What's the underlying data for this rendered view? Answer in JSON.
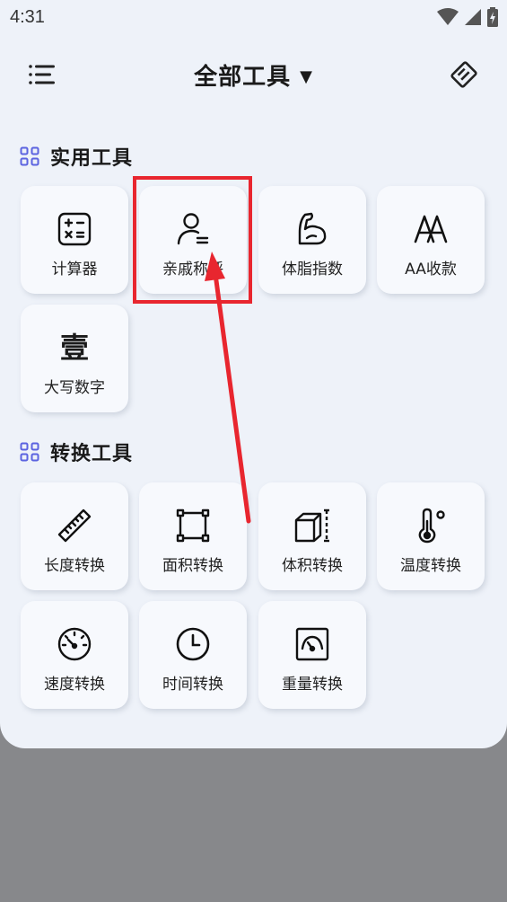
{
  "status": {
    "time": "4:31"
  },
  "header": {
    "title": "全部工具",
    "caret": "▼"
  },
  "sections": [
    {
      "title": "实用工具",
      "tools": [
        {
          "label": "计算器",
          "icon": "calculator-icon"
        },
        {
          "label": "亲戚称呼",
          "icon": "person-list-icon"
        },
        {
          "label": "体脂指数",
          "icon": "muscle-arm-icon"
        },
        {
          "label": "AA收款",
          "icon": "aa-letters-icon"
        },
        {
          "label": "大写数字",
          "icon": "chinese-numeral-icon",
          "glyph": "壹"
        }
      ]
    },
    {
      "title": "转换工具",
      "tools": [
        {
          "label": "长度转换",
          "icon": "ruler-icon"
        },
        {
          "label": "面积转换",
          "icon": "area-square-icon"
        },
        {
          "label": "体积转换",
          "icon": "cube-icon"
        },
        {
          "label": "温度转换",
          "icon": "thermometer-icon"
        },
        {
          "label": "速度转换",
          "icon": "speedometer-icon"
        },
        {
          "label": "时间转换",
          "icon": "clock-icon"
        },
        {
          "label": "重量转换",
          "icon": "scale-icon"
        }
      ]
    }
  ],
  "annotation": {
    "color": "#e8262f",
    "highlighted_tool": "亲戚称呼"
  }
}
